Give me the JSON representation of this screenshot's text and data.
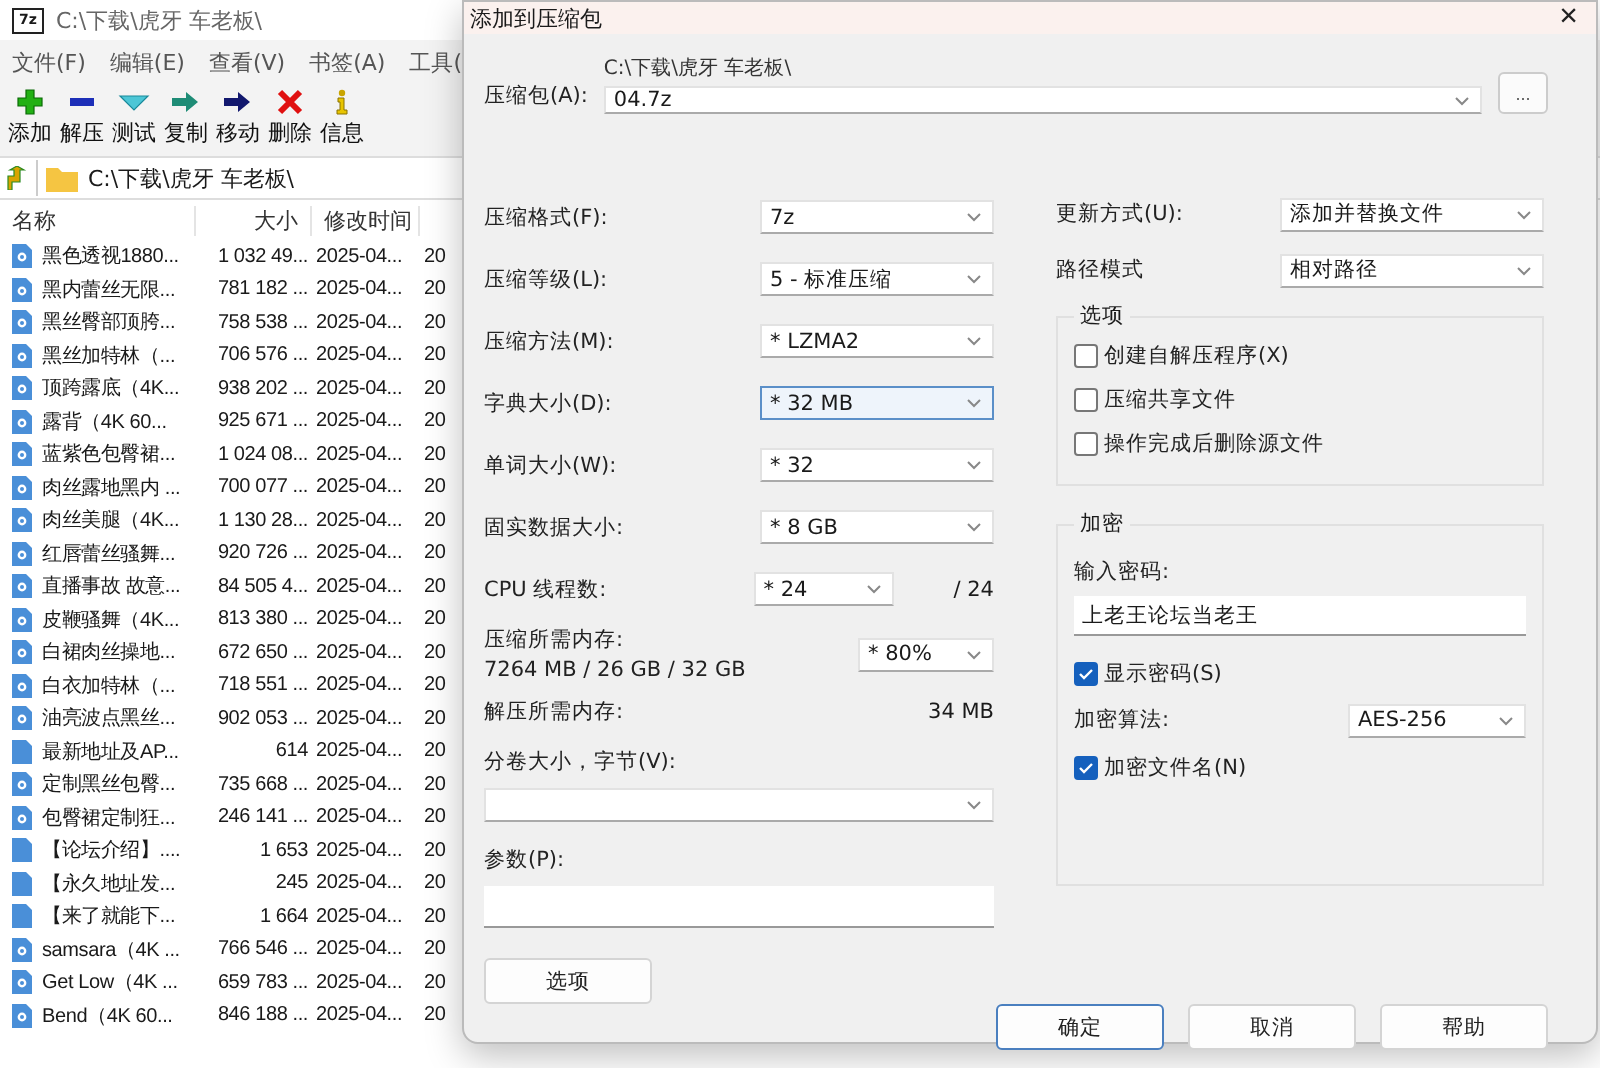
{
  "main_window": {
    "logo": "7z",
    "title": "C:\\下载\\虎牙 车老板\\",
    "menu": [
      "文件(F)",
      "编辑(E)",
      "查看(V)",
      "书签(A)",
      "工具("
    ],
    "toolbar": [
      {
        "label": "添加",
        "kind": "add"
      },
      {
        "label": "解压",
        "kind": "extract"
      },
      {
        "label": "测试",
        "kind": "test"
      },
      {
        "label": "复制",
        "kind": "copy"
      },
      {
        "label": "移动",
        "kind": "move"
      },
      {
        "label": "删除",
        "kind": "delete"
      },
      {
        "label": "信息",
        "kind": "info"
      }
    ],
    "path": "C:\\下载\\虎牙 车老板\\",
    "columns": [
      "名称",
      "大小",
      "修改时间"
    ],
    "rows": [
      {
        "name": "黑色透视1880...",
        "size": "1 032 49...",
        "modified": "2025-04...",
        "column_4": "20",
        "kind": "video"
      },
      {
        "name": "黑内蕾丝无限...",
        "size": "781 182 ...",
        "modified": "2025-04...",
        "column_4": "20",
        "kind": "video"
      },
      {
        "name": "黑丝臀部顶胯...",
        "size": "758 538 ...",
        "modified": "2025-04...",
        "column_4": "20",
        "kind": "video"
      },
      {
        "name": "黑丝加特林（...",
        "size": "706 576 ...",
        "modified": "2025-04...",
        "column_4": "20",
        "kind": "video"
      },
      {
        "name": "顶跨露底（4K...",
        "size": "938 202 ...",
        "modified": "2025-04...",
        "column_4": "20",
        "kind": "video"
      },
      {
        "name": "露背（4K 60...",
        "size": "925 671 ...",
        "modified": "2025-04...",
        "column_4": "20",
        "kind": "video"
      },
      {
        "name": "蓝紫色包臀裙...",
        "size": "1 024 08...",
        "modified": "2025-04...",
        "column_4": "20",
        "kind": "video"
      },
      {
        "name": "肉丝露地黑内 ...",
        "size": "700 077 ...",
        "modified": "2025-04...",
        "column_4": "20",
        "kind": "video"
      },
      {
        "name": "肉丝美腿（4K...",
        "size": "1 130 28...",
        "modified": "2025-04...",
        "column_4": "20",
        "kind": "video"
      },
      {
        "name": "红唇蕾丝骚舞...",
        "size": "920 726 ...",
        "modified": "2025-04...",
        "column_4": "20",
        "kind": "video"
      },
      {
        "name": "直播事故 故意...",
        "size": "84 505 4...",
        "modified": "2025-04...",
        "column_4": "20",
        "kind": "video"
      },
      {
        "name": "皮鞭骚舞（4K...",
        "size": "813 380 ...",
        "modified": "2025-04...",
        "column_4": "20",
        "kind": "video"
      },
      {
        "name": "白裙肉丝操地...",
        "size": "672 650 ...",
        "modified": "2025-04...",
        "column_4": "20",
        "kind": "video"
      },
      {
        "name": "白衣加特林（...",
        "size": "718 551 ...",
        "modified": "2025-04...",
        "column_4": "20",
        "kind": "video"
      },
      {
        "name": "油亮波点黑丝...",
        "size": "902 053 ...",
        "modified": "2025-04...",
        "column_4": "20",
        "kind": "video"
      },
      {
        "name": "最新地址及AP...",
        "size": "614",
        "modified": "2025-04...",
        "column_4": "20",
        "kind": "document"
      },
      {
        "name": "定制黑丝包臀...",
        "size": "735 668 ...",
        "modified": "2025-04...",
        "column_4": "20",
        "kind": "video"
      },
      {
        "name": "包臀裙定制狂...",
        "size": "246 141 ...",
        "modified": "2025-04...",
        "column_4": "20",
        "kind": "video"
      },
      {
        "name": "【论坛介绍】....",
        "size": "1 653",
        "modified": "2025-04...",
        "column_4": "20",
        "kind": "document"
      },
      {
        "name": "【永久地址发...",
        "size": "245",
        "modified": "2025-04...",
        "column_4": "20",
        "kind": "document"
      },
      {
        "name": "【来了就能下...",
        "size": "1 664",
        "modified": "2025-04...",
        "column_4": "20",
        "kind": "document"
      },
      {
        "name": "samsara（4K ...",
        "size": "766 546 ...",
        "modified": "2025-04...",
        "column_4": "20",
        "kind": "video"
      },
      {
        "name": "Get Low（4K ...",
        "size": "659 783 ...",
        "modified": "2025-04...",
        "column_4": "20",
        "kind": "video"
      },
      {
        "name": "Bend（4K 60...",
        "size": "846 188 ...",
        "modified": "2025-04...",
        "column_4": "20",
        "kind": "video"
      }
    ]
  },
  "dialog": {
    "title": "添加到压缩包",
    "close": "×",
    "archive": {
      "label": "压缩包(A):",
      "folder": "C:\\下载\\虎牙 车老板\\",
      "value": "04.7z"
    },
    "browse_button": "...",
    "settings": [
      {
        "label": "压缩格式(F):",
        "value": "7z",
        "focused": false
      },
      {
        "label": "压缩等级(L):",
        "value": "5 - 标准压缩",
        "focused": false
      },
      {
        "label": "压缩方法(M):",
        "value": "* LZMA2",
        "focused": false
      },
      {
        "label": "字典大小(D):",
        "value": "* 32 MB",
        "focused": true
      },
      {
        "label": "单词大小(W):",
        "value": "* 32",
        "focused": false
      },
      {
        "label": "固实数据大小:",
        "value": "* 8 GB",
        "focused": false
      }
    ],
    "cpu": {
      "label": "CPU 线程数:",
      "value": "* 24",
      "total": "/ 24"
    },
    "memory": {
      "label": "压缩所需内存:",
      "detail": "7264 MB / 26 GB / 32 GB",
      "value": "* 80%"
    },
    "decompress_memory": {
      "label": "解压所需内存:",
      "value": "34 MB"
    },
    "volume": {
      "label": "分卷大小，字节(V):"
    },
    "params": {
      "label": "参数(P):"
    },
    "options_button": "选项",
    "update_mode": {
      "label": "更新方式(U):",
      "value": "添加并替换文件"
    },
    "path_mode": {
      "label": "路径模式",
      "value": "相对路径"
    },
    "options_group": {
      "title": "选项",
      "checkboxes": [
        {
          "label": "创建自解压程序(X)",
          "checked": false
        },
        {
          "label": "压缩共享文件",
          "checked": false
        },
        {
          "label": "操作完成后删除源文件",
          "checked": false
        }
      ]
    },
    "encryption": {
      "title": "加密",
      "password_label": "输入密码:",
      "password": "上老王论坛当老王",
      "show_password": {
        "label": "显示密码(S)",
        "checked": true
      },
      "method": {
        "label": "加密算法:",
        "value": "AES-256"
      },
      "encrypt_names": {
        "label": "加密文件名(N)",
        "checked": true
      }
    },
    "buttons": [
      {
        "label": "确定",
        "default": true
      },
      {
        "label": "取消",
        "default": false
      },
      {
        "label": "帮助",
        "default": false
      }
    ]
  }
}
